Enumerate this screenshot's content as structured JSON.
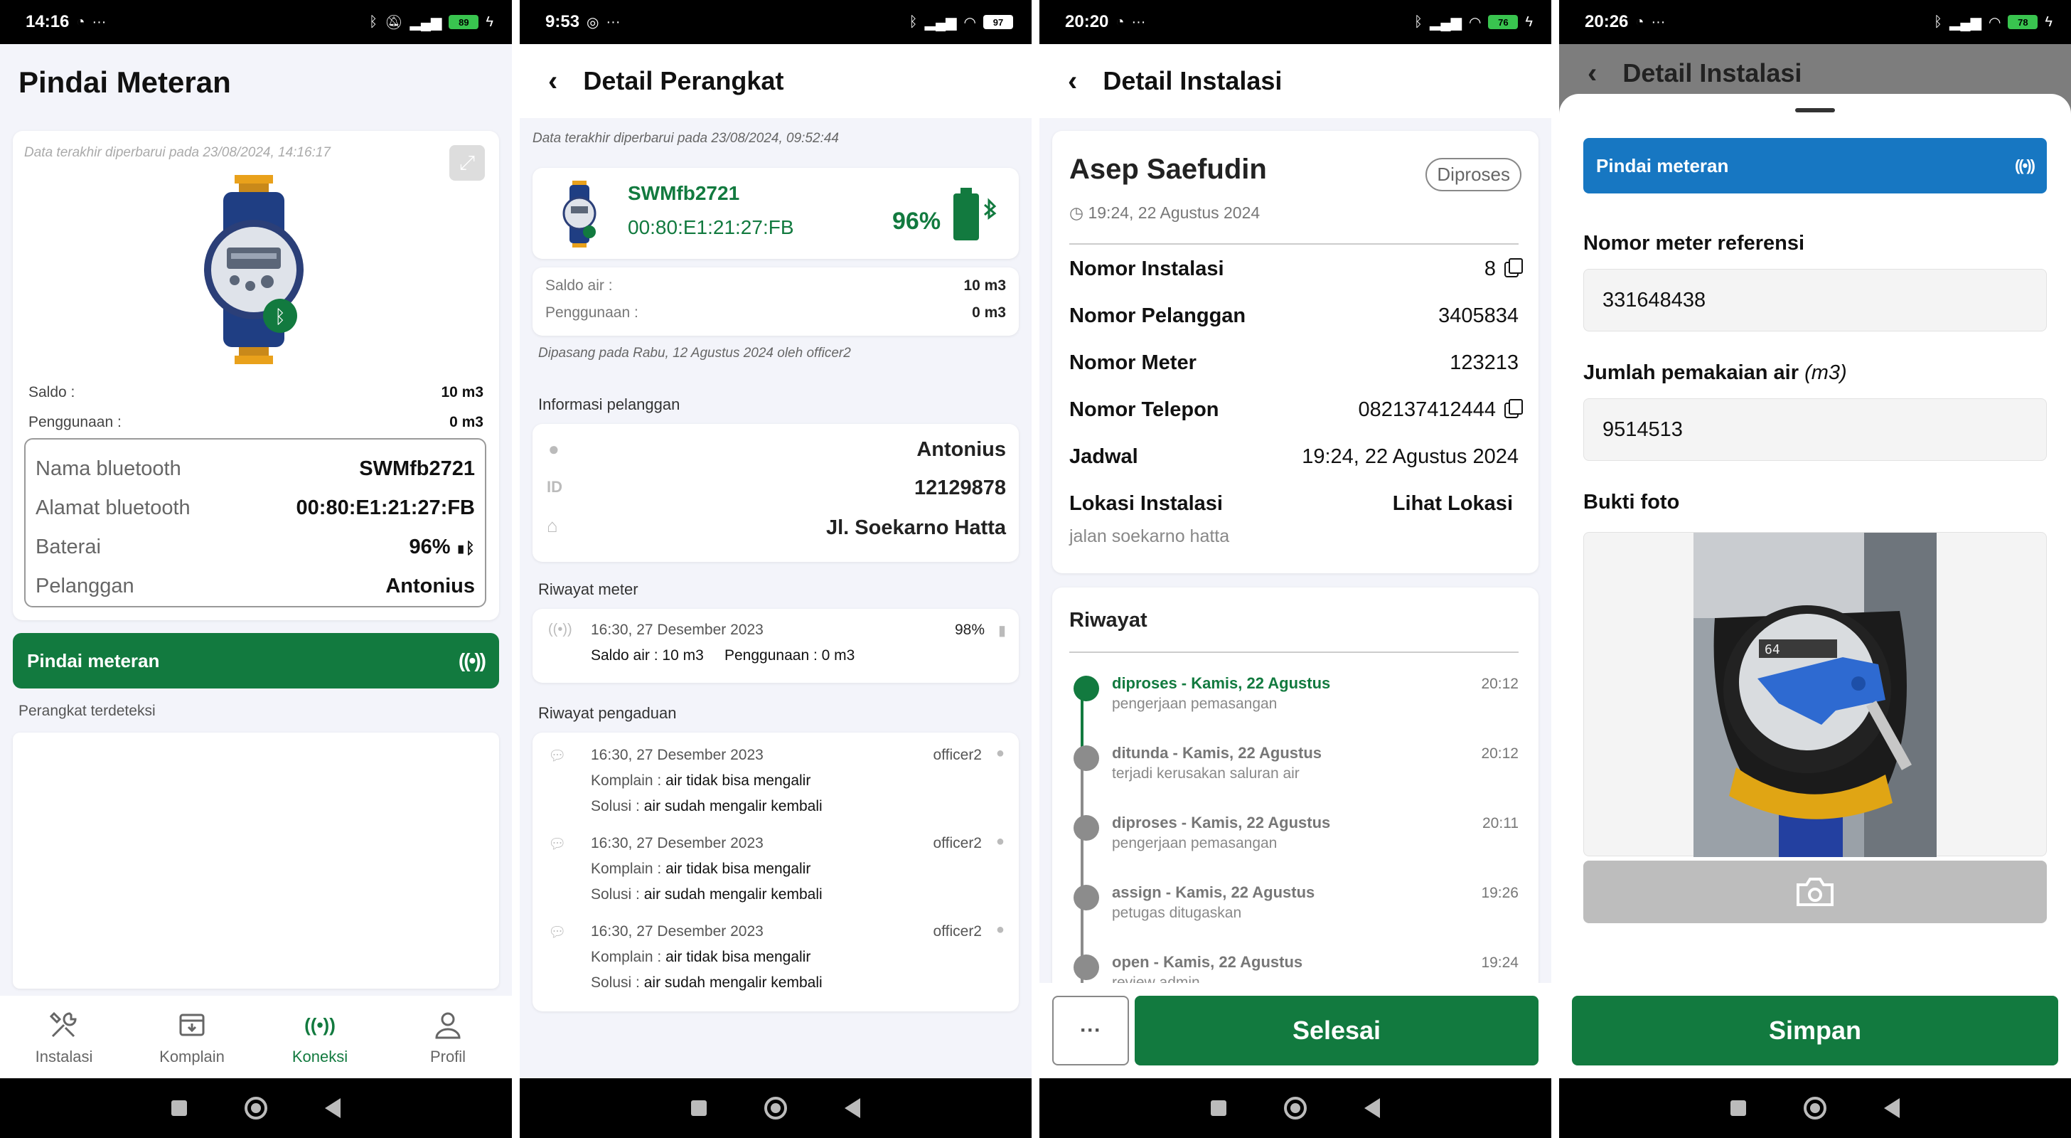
{
  "screens": [
    {
      "status": {
        "time": "14:16",
        "battery": "89"
      },
      "title": "Pindai Meteran",
      "updated": "Data terakhir diperbarui pada 23/08/2024, 14:16:17",
      "saldo_label": "Saldo :",
      "saldo_value": "10 m3",
      "usage_label": "Penggunaan :",
      "usage_value": "0 m3",
      "bt": {
        "name_label": "Nama bluetooth",
        "name_value": "SWMfb2721",
        "addr_label": "Alamat bluetooth",
        "addr_value": "00:80:E1:21:27:FB",
        "battery_label": "Baterai",
        "battery_value": "96%",
        "customer_label": "Pelanggan",
        "customer_value": "Antonius"
      },
      "scan_button": "Pindai meteran",
      "detected_label": "Perangkat terdeteksi",
      "bottom_nav": [
        {
          "label": "Instalasi",
          "icon": "tools-icon"
        },
        {
          "label": "Komplain",
          "icon": "inbox-icon"
        },
        {
          "label": "Koneksi",
          "icon": "broadcast-icon"
        },
        {
          "label": "Profil",
          "icon": "person-icon"
        }
      ]
    },
    {
      "status": {
        "time": "9:53",
        "battery": "97"
      },
      "title": "Detail Perangkat",
      "updated": "Data terakhir diperbarui pada 23/08/2024, 09:52:44",
      "device_name": "SWMfb2721",
      "device_addr": "00:80:E1:21:27:FB",
      "battery": "96%",
      "saldo_label": "Saldo air :",
      "saldo_value": "10 m3",
      "usage_label": "Penggunaan :",
      "usage_value": "0 m3",
      "installed": "Dipasang pada Rabu, 12 Agustus 2024 oleh officer2",
      "customer_section": "Informasi pelanggan",
      "customer_name": "Antonius",
      "customer_id": "12129878",
      "customer_address": "Jl. Soekarno Hatta",
      "meter_history_section": "Riwayat meter",
      "meter_history": {
        "time": "16:30, 27 Desember 2023",
        "battery": "98%",
        "saldo": "Saldo air : 10 m3",
        "usage": "Penggunaan : 0 m3"
      },
      "complaint_section": "Riwayat pengaduan",
      "complaints": [
        {
          "time": "16:30, 27 Desember 2023",
          "officer": "officer2",
          "complaint_label": "Komplain :",
          "complaint": "air tidak bisa mengalir",
          "solution_label": "Solusi :",
          "solution": "air sudah mengalir kembali"
        },
        {
          "time": "16:30, 27 Desember 2023",
          "officer": "officer2",
          "complaint_label": "Komplain :",
          "complaint": "air tidak bisa mengalir",
          "solution_label": "Solusi :",
          "solution": "air sudah mengalir kembali"
        },
        {
          "time": "16:30, 27 Desember 2023",
          "officer": "officer2",
          "complaint_label": "Komplain :",
          "complaint": "air tidak bisa mengalir",
          "solution_label": "Solusi :",
          "solution": "air sudah mengalir kembali"
        }
      ]
    },
    {
      "status": {
        "time": "20:20",
        "battery": "76"
      },
      "title": "Detail Instalasi",
      "customer_name": "Asep Saefudin",
      "badge": "Diproses",
      "timestamp": "19:24, 22 Agustus 2024",
      "rows": [
        {
          "label": "Nomor Instalasi",
          "value": "8"
        },
        {
          "label": "Nomor Pelanggan",
          "value": "3405834"
        },
        {
          "label": "Nomor Meter",
          "value": "123213"
        },
        {
          "label": "Nomor Telepon",
          "value": "082137412444"
        },
        {
          "label": "Jadwal",
          "value": "19:24, 22 Agustus 2024"
        }
      ],
      "location_label": "Lokasi Instalasi",
      "location_link": "Lihat Lokasi",
      "location_text": "jalan soekarno hatta",
      "history_title": "Riwayat",
      "history": [
        {
          "title": "diproses - Kamis, 22 Agustus",
          "sub": "pengerjaan pemasangan",
          "time": "20:12"
        },
        {
          "title": "ditunda - Kamis, 22 Agustus",
          "sub": "terjadi kerusakan saluran air",
          "time": "20:12"
        },
        {
          "title": "diproses - Kamis, 22 Agustus",
          "sub": "pengerjaan pemasangan",
          "time": "20:11"
        },
        {
          "title": "assign - Kamis, 22 Agustus",
          "sub": "petugas ditugaskan",
          "time": "19:26"
        },
        {
          "title": "open - Kamis, 22 Agustus",
          "sub": "review admin",
          "time": "19:24"
        }
      ],
      "more_button": "···",
      "finish_button": "Selesai"
    },
    {
      "status": {
        "time": "20:26",
        "battery": "78"
      },
      "title": "Detail Instalasi",
      "scan_button": "Pindai meteran",
      "ref_label": "Nomor meter referensi",
      "ref_value": "331648438",
      "usage_label": "Jumlah pemakaian air",
      "usage_unit": "(m3)",
      "usage_value": "9514513",
      "photo_label": "Bukti foto",
      "save_button": "Simpan"
    }
  ],
  "colors": {
    "primary_green": "#127a3f",
    "blue": "#1777c2",
    "grey_dot": "#8c8c8c"
  }
}
